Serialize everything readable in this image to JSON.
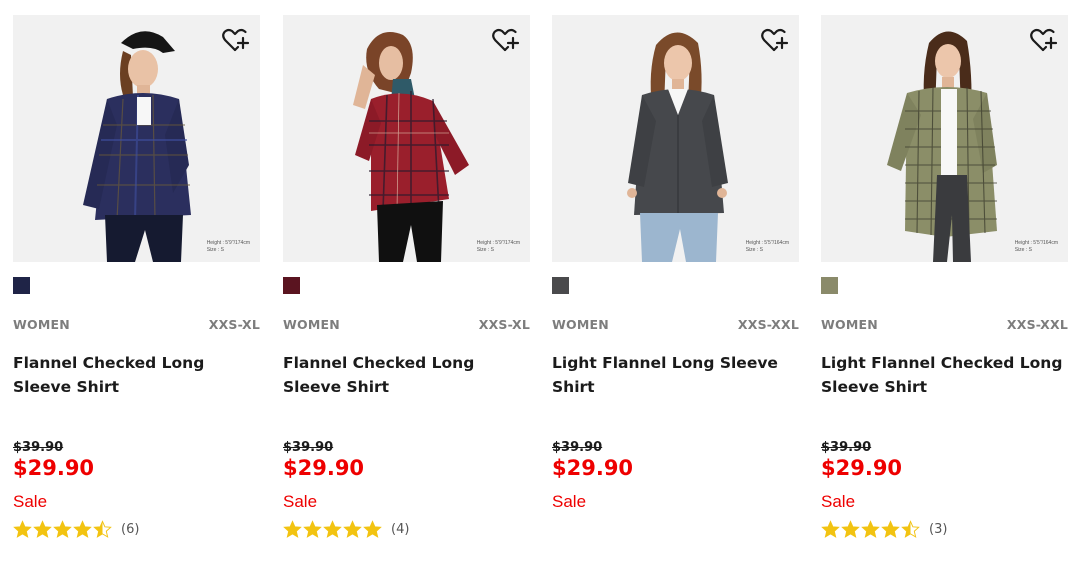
{
  "colors": {
    "sale_red": "#ee0000",
    "star_gold": "#f2c311",
    "meta_gray": "#7d7d7d"
  },
  "products": [
    {
      "gender": "WOMEN",
      "sizes": "XXS-XL",
      "name": "Flannel Checked Long Sleeve Shirt",
      "original_price": "$39.90",
      "price": "$29.90",
      "sale_label": "Sale",
      "rating": 4.5,
      "review_count": "(6)",
      "swatch_color": "#1f2447",
      "photo_caption_line1": "Height : 5'9\"/174cm",
      "photo_caption_line2": "Size : S",
      "favorite_icon": "heart-plus-icon"
    },
    {
      "gender": "WOMEN",
      "sizes": "XXS-XL",
      "name": "Flannel Checked Long Sleeve Shirt",
      "original_price": "$39.90",
      "price": "$29.90",
      "sale_label": "Sale",
      "rating": 5,
      "review_count": "(4)",
      "swatch_color": "#5a1420",
      "photo_caption_line1": "Height : 5'9\"/174cm",
      "photo_caption_line2": "Size : S",
      "favorite_icon": "heart-plus-icon"
    },
    {
      "gender": "WOMEN",
      "sizes": "XXS-XXL",
      "name": "Light Flannel Long Sleeve Shirt",
      "original_price": "$39.90",
      "price": "$29.90",
      "sale_label": "Sale",
      "rating": null,
      "review_count": "",
      "swatch_color": "#4a4a4c",
      "photo_caption_line1": "Height : 5'5\"/164cm",
      "photo_caption_line2": "Size : S",
      "favorite_icon": "heart-plus-icon"
    },
    {
      "gender": "WOMEN",
      "sizes": "XXS-XXL",
      "name": "Light Flannel Checked Long Sleeve Shirt",
      "original_price": "$39.90",
      "price": "$29.90",
      "sale_label": "Sale",
      "rating": 4.5,
      "review_count": "(3)",
      "swatch_color": "#8a8a6a",
      "photo_caption_line1": "Height : 5'5\"/164cm",
      "photo_caption_line2": "Size : S",
      "favorite_icon": "heart-plus-icon"
    }
  ]
}
